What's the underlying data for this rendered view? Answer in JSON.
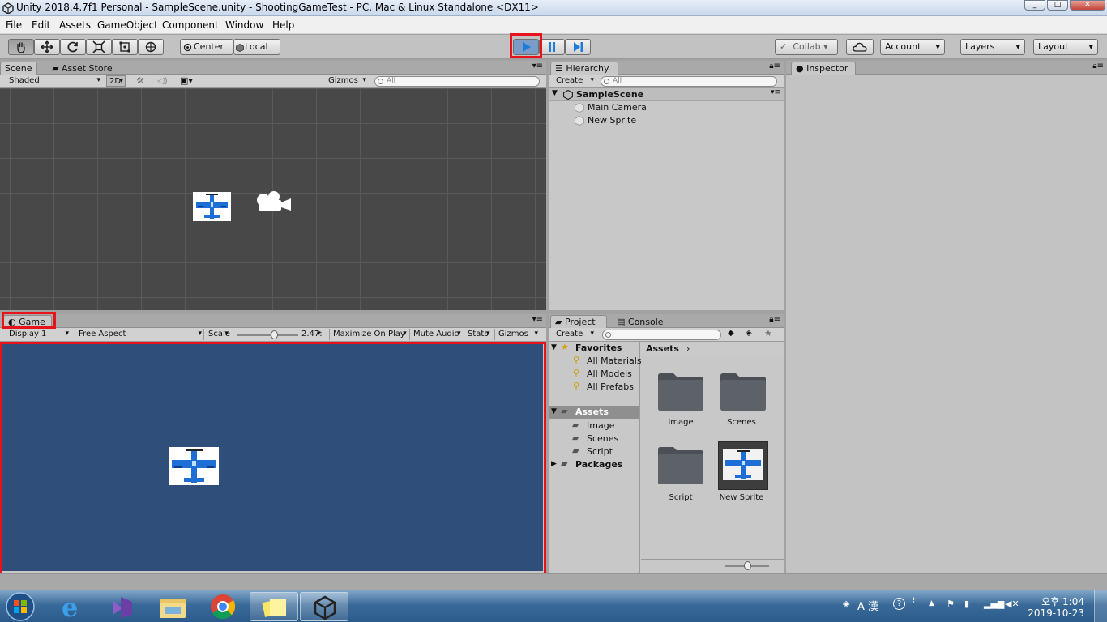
{
  "window": {
    "title": "Unity 2018.4.7f1 Personal - SampleScene.unity - ShootingGameTest - PC, Mac & Linux Standalone <DX11>",
    "min": "_",
    "max": "□",
    "close": "✕"
  },
  "menu": [
    "File",
    "Edit",
    "Assets",
    "GameObject",
    "Component",
    "Window",
    "Help"
  ],
  "toolbar": {
    "pivot": "Center",
    "space": "Local",
    "collab": "Collab",
    "account": "Account",
    "layers": "Layers",
    "layout": "Layout"
  },
  "scene": {
    "tab": "Scene",
    "tab2": "Asset Store",
    "shading": "Shaded",
    "mode2d": "2D",
    "gizmos": "Gizmos",
    "search": "All"
  },
  "game": {
    "tab": "Game",
    "display": "Display 1",
    "aspect": "Free Aspect",
    "scale_label": "Scale",
    "scale_value": "2.47:",
    "scale_fraction": 0.6,
    "maximize": "Maximize On Play",
    "mute": "Mute Audio",
    "stats": "Stats",
    "gizmos": "Gizmos",
    "bg_color": "#2f4e7a"
  },
  "hierarchy": {
    "tab": "Hierarchy",
    "create": "Create",
    "search": "All",
    "scene": "SampleScene",
    "items": [
      "Main Camera",
      "New Sprite"
    ]
  },
  "inspector": {
    "tab": "Inspector"
  },
  "project": {
    "tab": "Project",
    "tab2": "Console",
    "create": "Create",
    "favorites_label": "Favorites",
    "favorites": [
      "All Materials",
      "All Models",
      "All Prefabs"
    ],
    "assets_label": "Assets",
    "asset_folders": [
      "Image",
      "Scenes",
      "Script"
    ],
    "packages": "Packages",
    "breadcrumb": "Assets",
    "grid": [
      "Image",
      "Scenes",
      "Script",
      "New Sprite"
    ]
  },
  "taskbar": {
    "ime": "A 漢",
    "time": "오후 1:04",
    "date": "2019-10-23"
  },
  "colors": {
    "accent_red": "#e8121a",
    "play_blue": "#1f7bd8",
    "scene_bg": "#484848"
  }
}
